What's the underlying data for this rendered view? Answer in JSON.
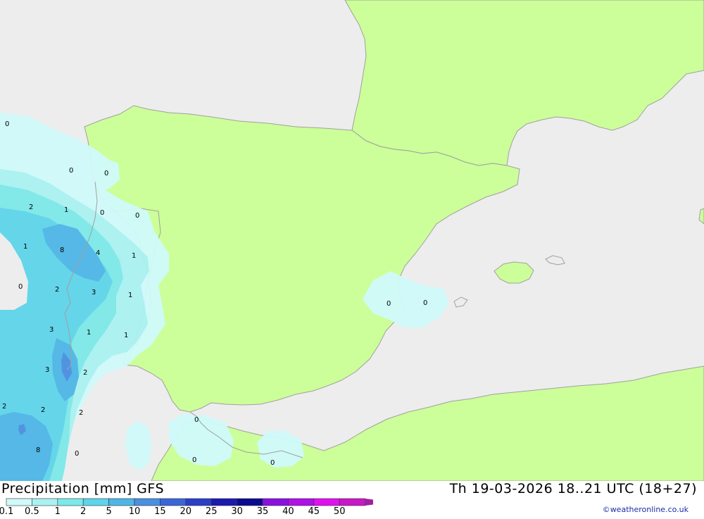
{
  "map": {
    "colors": {
      "sea": "#ededed",
      "land": "#ccff99",
      "border": "#a0a0a0"
    },
    "contour_labels": [
      "0",
      "0",
      "0",
      "2",
      "1",
      "0",
      "0",
      "1",
      "8",
      "4",
      "1",
      "0",
      "2",
      "3",
      "1",
      "3",
      "1",
      "1",
      "3",
      "2",
      "2",
      "2",
      "2",
      "8",
      "0",
      "0",
      "0",
      "0",
      "0"
    ]
  },
  "footer": {
    "title": "Precipitation [mm] GFS",
    "timestamp": "Th 19-03-2026 18..21 UTC (18+27)",
    "credit": "©weatheronline.co.uk"
  },
  "legend": {
    "labels": [
      "0.1",
      "0.5",
      "1",
      "2",
      "5",
      "10",
      "15",
      "20",
      "25",
      "30",
      "35",
      "40",
      "45",
      "50"
    ],
    "colors": [
      "#d0fafa",
      "#aaf2f2",
      "#7de8e8",
      "#5ed4ea",
      "#4db6e6",
      "#4a8fe0",
      "#3a66d8",
      "#2a3ec8",
      "#1a1ab0",
      "#0a0a90",
      "#8a10e0",
      "#b010e8",
      "#e010f0",
      "#c818c8",
      "#a020a0"
    ]
  }
}
